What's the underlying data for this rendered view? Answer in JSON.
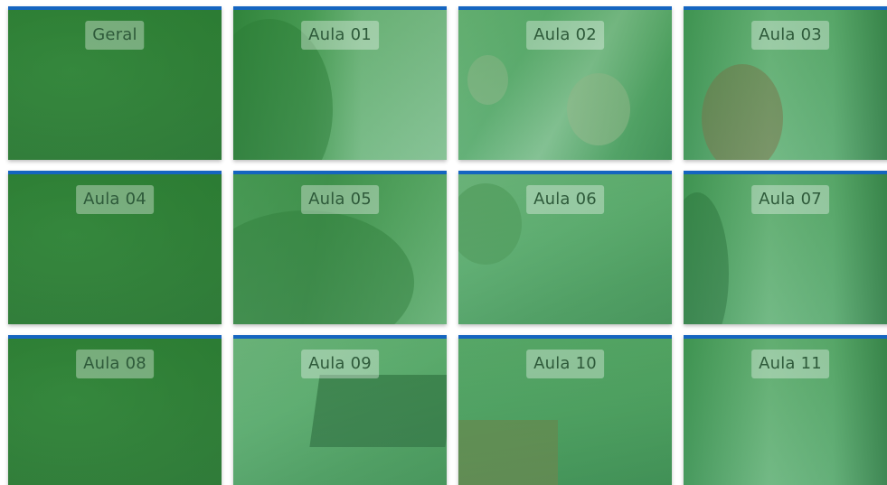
{
  "tiles": [
    {
      "label": "Geral"
    },
    {
      "label": "Aula 01"
    },
    {
      "label": "Aula 02"
    },
    {
      "label": "Aula 03"
    },
    {
      "label": "Aula 04"
    },
    {
      "label": "Aula 05"
    },
    {
      "label": "Aula 06"
    },
    {
      "label": "Aula 07"
    },
    {
      "label": "Aula 08"
    },
    {
      "label": "Aula 09"
    },
    {
      "label": "Aula 10"
    },
    {
      "label": "Aula 11"
    }
  ],
  "colors": {
    "top_border": "#1565c0",
    "overlay": "#2e8c3c",
    "label_text": "#2e5a3a"
  }
}
